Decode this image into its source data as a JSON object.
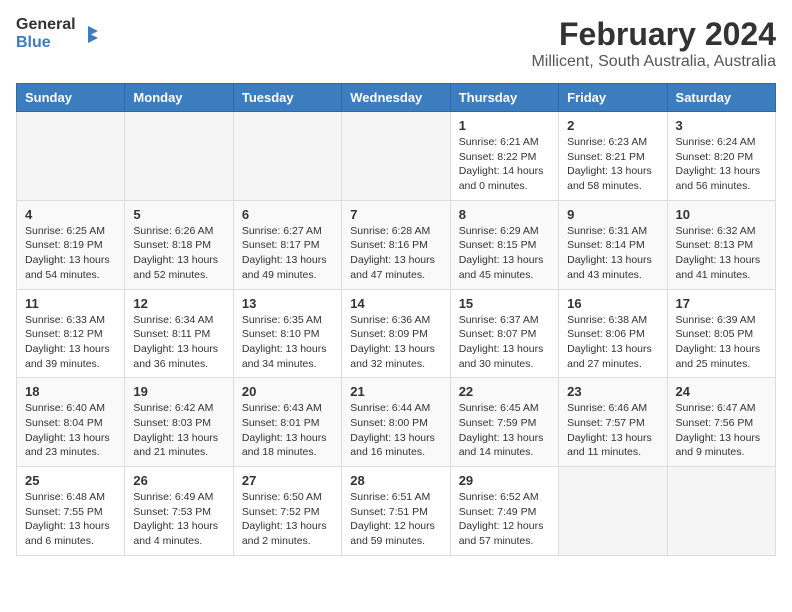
{
  "header": {
    "logo_line1": "General",
    "logo_line2": "Blue",
    "title": "February 2024",
    "subtitle": "Millicent, South Australia, Australia"
  },
  "weekdays": [
    "Sunday",
    "Monday",
    "Tuesday",
    "Wednesday",
    "Thursday",
    "Friday",
    "Saturday"
  ],
  "weeks": [
    [
      {
        "day": "",
        "info": ""
      },
      {
        "day": "",
        "info": ""
      },
      {
        "day": "",
        "info": ""
      },
      {
        "day": "",
        "info": ""
      },
      {
        "day": "1",
        "info": "Sunrise: 6:21 AM\nSunset: 8:22 PM\nDaylight: 14 hours\nand 0 minutes."
      },
      {
        "day": "2",
        "info": "Sunrise: 6:23 AM\nSunset: 8:21 PM\nDaylight: 13 hours\nand 58 minutes."
      },
      {
        "day": "3",
        "info": "Sunrise: 6:24 AM\nSunset: 8:20 PM\nDaylight: 13 hours\nand 56 minutes."
      }
    ],
    [
      {
        "day": "4",
        "info": "Sunrise: 6:25 AM\nSunset: 8:19 PM\nDaylight: 13 hours\nand 54 minutes."
      },
      {
        "day": "5",
        "info": "Sunrise: 6:26 AM\nSunset: 8:18 PM\nDaylight: 13 hours\nand 52 minutes."
      },
      {
        "day": "6",
        "info": "Sunrise: 6:27 AM\nSunset: 8:17 PM\nDaylight: 13 hours\nand 49 minutes."
      },
      {
        "day": "7",
        "info": "Sunrise: 6:28 AM\nSunset: 8:16 PM\nDaylight: 13 hours\nand 47 minutes."
      },
      {
        "day": "8",
        "info": "Sunrise: 6:29 AM\nSunset: 8:15 PM\nDaylight: 13 hours\nand 45 minutes."
      },
      {
        "day": "9",
        "info": "Sunrise: 6:31 AM\nSunset: 8:14 PM\nDaylight: 13 hours\nand 43 minutes."
      },
      {
        "day": "10",
        "info": "Sunrise: 6:32 AM\nSunset: 8:13 PM\nDaylight: 13 hours\nand 41 minutes."
      }
    ],
    [
      {
        "day": "11",
        "info": "Sunrise: 6:33 AM\nSunset: 8:12 PM\nDaylight: 13 hours\nand 39 minutes."
      },
      {
        "day": "12",
        "info": "Sunrise: 6:34 AM\nSunset: 8:11 PM\nDaylight: 13 hours\nand 36 minutes."
      },
      {
        "day": "13",
        "info": "Sunrise: 6:35 AM\nSunset: 8:10 PM\nDaylight: 13 hours\nand 34 minutes."
      },
      {
        "day": "14",
        "info": "Sunrise: 6:36 AM\nSunset: 8:09 PM\nDaylight: 13 hours\nand 32 minutes."
      },
      {
        "day": "15",
        "info": "Sunrise: 6:37 AM\nSunset: 8:07 PM\nDaylight: 13 hours\nand 30 minutes."
      },
      {
        "day": "16",
        "info": "Sunrise: 6:38 AM\nSunset: 8:06 PM\nDaylight: 13 hours\nand 27 minutes."
      },
      {
        "day": "17",
        "info": "Sunrise: 6:39 AM\nSunset: 8:05 PM\nDaylight: 13 hours\nand 25 minutes."
      }
    ],
    [
      {
        "day": "18",
        "info": "Sunrise: 6:40 AM\nSunset: 8:04 PM\nDaylight: 13 hours\nand 23 minutes."
      },
      {
        "day": "19",
        "info": "Sunrise: 6:42 AM\nSunset: 8:03 PM\nDaylight: 13 hours\nand 21 minutes."
      },
      {
        "day": "20",
        "info": "Sunrise: 6:43 AM\nSunset: 8:01 PM\nDaylight: 13 hours\nand 18 minutes."
      },
      {
        "day": "21",
        "info": "Sunrise: 6:44 AM\nSunset: 8:00 PM\nDaylight: 13 hours\nand 16 minutes."
      },
      {
        "day": "22",
        "info": "Sunrise: 6:45 AM\nSunset: 7:59 PM\nDaylight: 13 hours\nand 14 minutes."
      },
      {
        "day": "23",
        "info": "Sunrise: 6:46 AM\nSunset: 7:57 PM\nDaylight: 13 hours\nand 11 minutes."
      },
      {
        "day": "24",
        "info": "Sunrise: 6:47 AM\nSunset: 7:56 PM\nDaylight: 13 hours\nand 9 minutes."
      }
    ],
    [
      {
        "day": "25",
        "info": "Sunrise: 6:48 AM\nSunset: 7:55 PM\nDaylight: 13 hours\nand 6 minutes."
      },
      {
        "day": "26",
        "info": "Sunrise: 6:49 AM\nSunset: 7:53 PM\nDaylight: 13 hours\nand 4 minutes."
      },
      {
        "day": "27",
        "info": "Sunrise: 6:50 AM\nSunset: 7:52 PM\nDaylight: 13 hours\nand 2 minutes."
      },
      {
        "day": "28",
        "info": "Sunrise: 6:51 AM\nSunset: 7:51 PM\nDaylight: 12 hours\nand 59 minutes."
      },
      {
        "day": "29",
        "info": "Sunrise: 6:52 AM\nSunset: 7:49 PM\nDaylight: 12 hours\nand 57 minutes."
      },
      {
        "day": "",
        "info": ""
      },
      {
        "day": "",
        "info": ""
      }
    ]
  ]
}
